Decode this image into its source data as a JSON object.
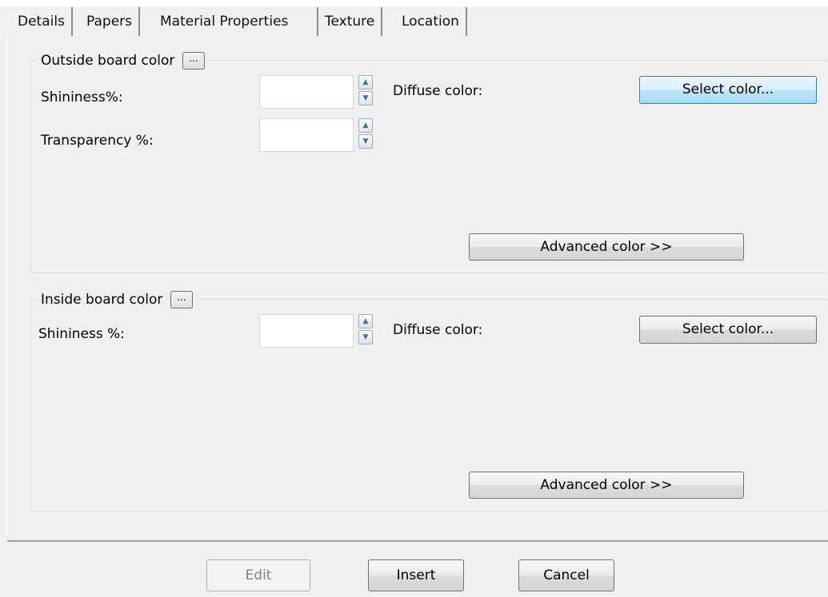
{
  "tabs": [
    "Details",
    "Papers",
    "Material Properties",
    "Texture",
    "Location"
  ],
  "outside": {
    "legend": "Outside board color",
    "dots": "...",
    "shininess_label": "Shininess%:",
    "transparency_label": "Transparency %:",
    "diffuse_label": "Diffuse color:",
    "select_color": "Select color...",
    "advanced_color": "Advanced color >>"
  },
  "inside": {
    "legend": "Inside board color",
    "dots": "...",
    "shininess_label": "Shininess %:",
    "diffuse_label": "Diffuse color:",
    "select_color": "Select color...",
    "advanced_color": "Advanced color >>"
  },
  "footer": {
    "edit": "Edit",
    "insert": "Insert",
    "cancel": "Cancel"
  },
  "spin": {
    "up": "▲",
    "down": "▼"
  }
}
